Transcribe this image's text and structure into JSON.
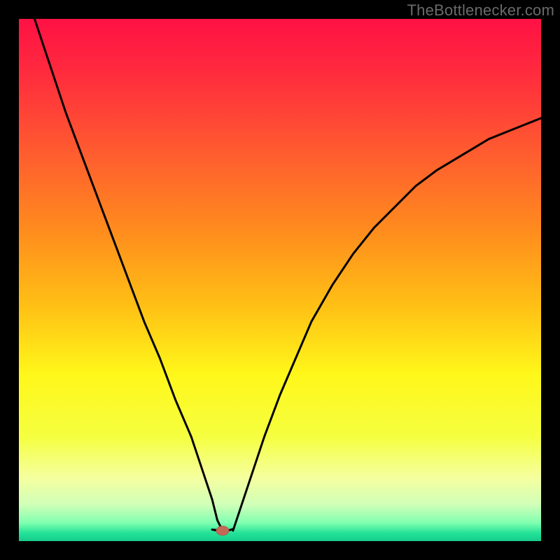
{
  "watermark": "TheBottlenecker.com",
  "colors": {
    "frame": "#000000",
    "gradient_stops": [
      {
        "offset": 0.0,
        "color": "#ff1144"
      },
      {
        "offset": 0.1,
        "color": "#ff2a3e"
      },
      {
        "offset": 0.25,
        "color": "#ff5a30"
      },
      {
        "offset": 0.4,
        "color": "#ff8a1e"
      },
      {
        "offset": 0.55,
        "color": "#ffc015"
      },
      {
        "offset": 0.68,
        "color": "#fff71a"
      },
      {
        "offset": 0.8,
        "color": "#f5ff40"
      },
      {
        "offset": 0.88,
        "color": "#f5ffa0"
      },
      {
        "offset": 0.93,
        "color": "#d0ffb8"
      },
      {
        "offset": 0.965,
        "color": "#80ffb0"
      },
      {
        "offset": 0.985,
        "color": "#22e298"
      },
      {
        "offset": 1.0,
        "color": "#18cc8d"
      }
    ],
    "curve": "#000000",
    "marker_fill": "#c06a57",
    "marker_stroke": "#b95a48"
  },
  "chart_data": {
    "type": "line",
    "title": "",
    "xlabel": "",
    "ylabel": "",
    "xlim": [
      0,
      100
    ],
    "ylim": [
      0,
      100
    ],
    "grid": false,
    "legend": false,
    "marker": {
      "x": 39,
      "y": 2
    },
    "series": [
      {
        "name": "left-branch",
        "x": [
          3,
          6,
          9,
          12,
          15,
          18,
          21,
          24,
          27,
          30,
          33,
          35,
          37,
          38,
          39
        ],
        "y": [
          100,
          91,
          82,
          74,
          66,
          58,
          50,
          42,
          35,
          27,
          20,
          14,
          8,
          4,
          2
        ]
      },
      {
        "name": "valley-floor",
        "x": [
          37,
          38,
          39,
          40,
          41
        ],
        "y": [
          2.2,
          2.0,
          1.8,
          2.0,
          2.3
        ]
      },
      {
        "name": "right-branch",
        "x": [
          41,
          43,
          45,
          47,
          50,
          53,
          56,
          60,
          64,
          68,
          72,
          76,
          80,
          85,
          90,
          95,
          100
        ],
        "y": [
          2,
          8,
          14,
          20,
          28,
          35,
          42,
          49,
          55,
          60,
          64,
          68,
          71,
          74,
          77,
          79,
          81
        ]
      }
    ]
  }
}
